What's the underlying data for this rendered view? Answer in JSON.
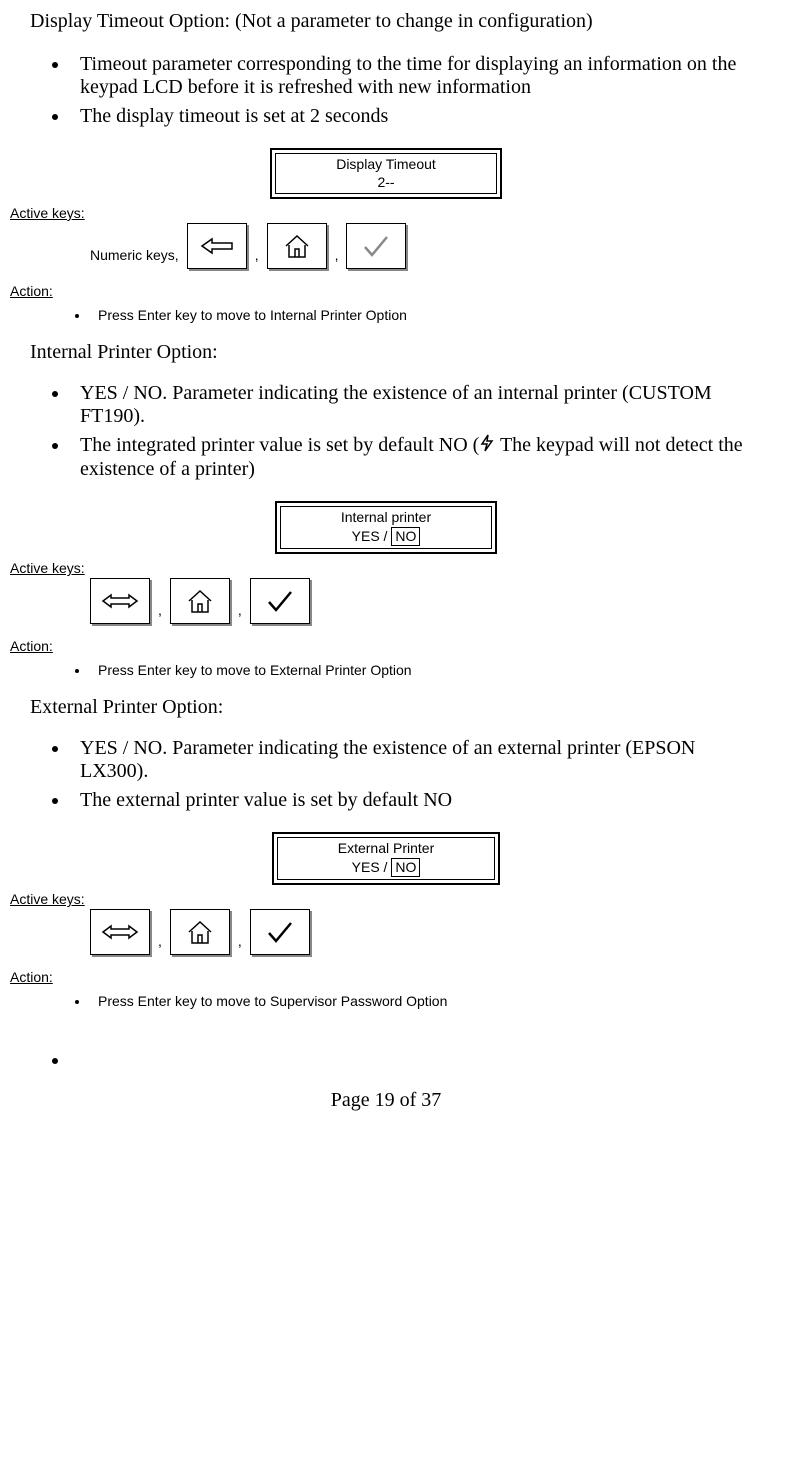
{
  "section1": {
    "title": "Display Timeout Option: (Not a parameter to change in configuration)",
    "bullets": [
      "Timeout parameter corresponding to the time for displaying an information on the keypad LCD before it is refreshed with new information",
      "The display timeout is set at 2 seconds"
    ],
    "lcd": {
      "line1": "Display Timeout",
      "line2": "2--"
    },
    "activeKeysLabel": "Active keys:",
    "numericKeysPrefix": "Numeric keys,",
    "actionLabel": "Action:",
    "actionItem": "Press Enter key to move to Internal Printer Option"
  },
  "section2": {
    "title": "Internal Printer Option:",
    "bullets_a": "YES / NO. Parameter indicating the existence of an internal printer (CUSTOM FT190).",
    "bullets_b_pre": "The integrated printer value is set by default NO (",
    "bullets_b_post": " The keypad will not detect the existence of a printer)",
    "lcd": {
      "line1": "Internal printer",
      "line2_pre": "YES  /  ",
      "line2_sel": "NO"
    },
    "activeKeysLabel": "Active keys:",
    "actionLabel": "Action:",
    "actionItem": "Press Enter key to move to External Printer Option"
  },
  "section3": {
    "title": "External Printer Option:",
    "bullets": [
      "YES / NO. Parameter indicating the existence of an external printer (EPSON LX300).",
      "The external printer value is set by default NO"
    ],
    "lcd": {
      "line1": "External Printer",
      "line2_pre": "YES / ",
      "line2_sel": "NO"
    },
    "activeKeysLabel": "Active keys:",
    "actionLabel": "Action:",
    "actionItem": "Press Enter key to move to Supervisor Password Option"
  },
  "footer": "Page 19 of 37"
}
